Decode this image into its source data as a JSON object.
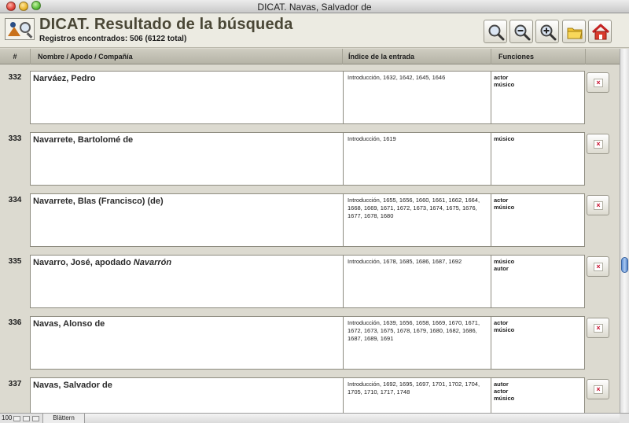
{
  "window": {
    "title": "DICAT. Navas, Salvador de"
  },
  "header": {
    "title": "DICAT. Resultado de la búsqueda",
    "records": "Registros encontrados: 506 (6122 total)",
    "toolbar": [
      {
        "icon": "search-icon"
      },
      {
        "icon": "zoom-out-icon"
      },
      {
        "icon": "zoom-in-icon"
      },
      {
        "icon": "folder-icon"
      },
      {
        "icon": "home-icon"
      }
    ]
  },
  "columns": {
    "num": "#",
    "name": "Nombre / Apodo / Compañía",
    "index": "Índice de la entrada",
    "functions": "Funciones"
  },
  "rows": [
    {
      "num": "332",
      "name": "Narváez, Pedro",
      "nickname": "",
      "index": "Introducción, 1632, 1642, 1645, 1646",
      "functions": [
        "actor",
        "músico"
      ],
      "delete": "×"
    },
    {
      "num": "333",
      "name": "Navarrete, Bartolomé de",
      "nickname": "",
      "index": "Introducción, 1619",
      "functions": [
        "músico"
      ],
      "delete": "×"
    },
    {
      "num": "334",
      "name": "Navarrete, Blas (Francisco) (de)",
      "nickname": "",
      "index": "Introducción, 1655, 1656, 1660, 1661, 1662, 1664, 1668, 1669, 1671, 1672, 1673, 1674, 1675, 1676, 1677, 1678, 1680",
      "functions": [
        "actor",
        "músico"
      ],
      "delete": "×"
    },
    {
      "num": "335",
      "name": "Navarro, José, apodado ",
      "nickname": "Navarrón",
      "index": "Introducción, 1678, 1685, 1686, 1687, 1692",
      "functions": [
        "músico",
        "autor"
      ],
      "delete": "×"
    },
    {
      "num": "336",
      "name": "Navas, Alonso de",
      "nickname": "",
      "index": "Introducción, 1639, 1656, 1658, 1669, 1670, 1671, 1672, 1673, 1675, 1678, 1679, 1680, 1682, 1686, 1687, 1689, 1691",
      "functions": [
        "actor",
        "músico"
      ],
      "delete": "×"
    },
    {
      "num": "337",
      "name": "Navas, Salvador de",
      "nickname": "",
      "index": "Introducción, 1692, 1695, 1697, 1701, 1702, 1704, 1705, 1710, 1717, 1748",
      "functions": [
        "autor",
        "actor",
        "músico"
      ],
      "delete": "×"
    }
  ],
  "statusbar": {
    "zoom": "100",
    "mode": "Blättern"
  },
  "scroll": {
    "position": 0.6
  }
}
